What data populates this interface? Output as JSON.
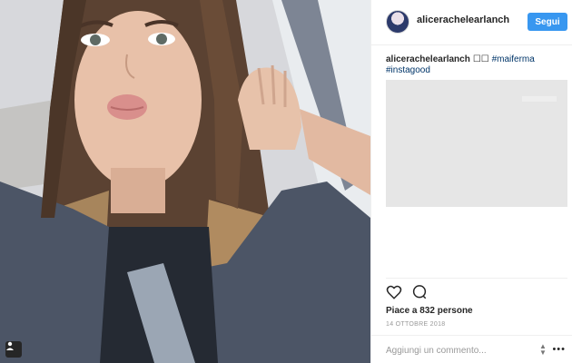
{
  "header": {
    "username": "alicerachelearlanch",
    "follow_label": "Segui"
  },
  "caption": {
    "username": "alicerachelearlanch",
    "emoji": "☐☐",
    "hashtag_1": "#maiferma",
    "hashtag_2": "#instagood"
  },
  "stats": {
    "likes": "Piace a 832 persone",
    "date": "14 OTTOBRE 2018"
  },
  "comment": {
    "placeholder": "Aggiungi un commento..."
  },
  "icons": {
    "like": "heart-icon",
    "comment": "speech-bubble-icon",
    "tag": "user-tag-icon",
    "more": "more-options-icon"
  },
  "colors": {
    "follow_button": "#3897f0",
    "hashtag": "#003569",
    "border": "#efefef"
  }
}
